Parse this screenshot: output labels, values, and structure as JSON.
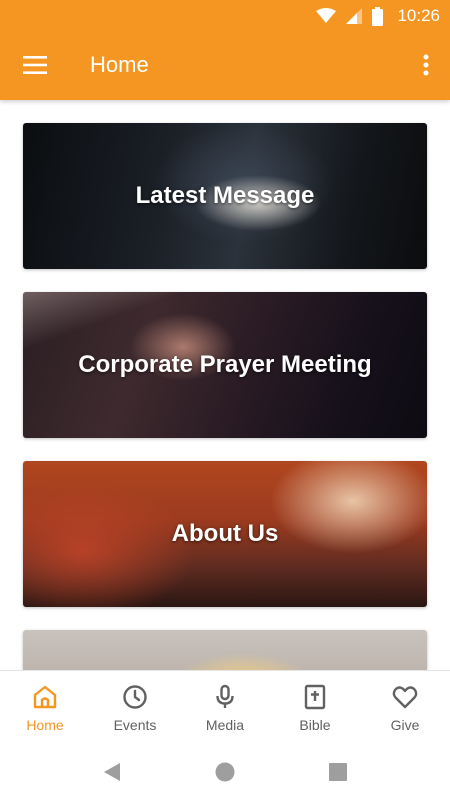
{
  "status_bar": {
    "time": "10:26",
    "icons": [
      "wifi-icon",
      "signal-icon",
      "battery-icon"
    ]
  },
  "toolbar": {
    "title": "Home",
    "menu_icon": "hamburger-menu-icon",
    "overflow_icon": "more-vert-icon"
  },
  "cards": [
    {
      "label": "Latest Message"
    },
    {
      "label": "Corporate Prayer Meeting"
    },
    {
      "label": "About Us"
    },
    {
      "label": ""
    }
  ],
  "bottom_nav": {
    "items": [
      {
        "label": "Home",
        "icon": "home-icon",
        "active": true
      },
      {
        "label": "Events",
        "icon": "clock-icon",
        "active": false
      },
      {
        "label": "Media",
        "icon": "microphone-icon",
        "active": false
      },
      {
        "label": "Bible",
        "icon": "bible-icon",
        "active": false
      },
      {
        "label": "Give",
        "icon": "heart-icon",
        "active": false
      }
    ]
  },
  "system_nav": {
    "icons": [
      "back-icon",
      "home-circle-icon",
      "recents-icon"
    ]
  },
  "colors": {
    "primary": "#f59622",
    "inactive": "#616161",
    "background": "#ffffff"
  }
}
